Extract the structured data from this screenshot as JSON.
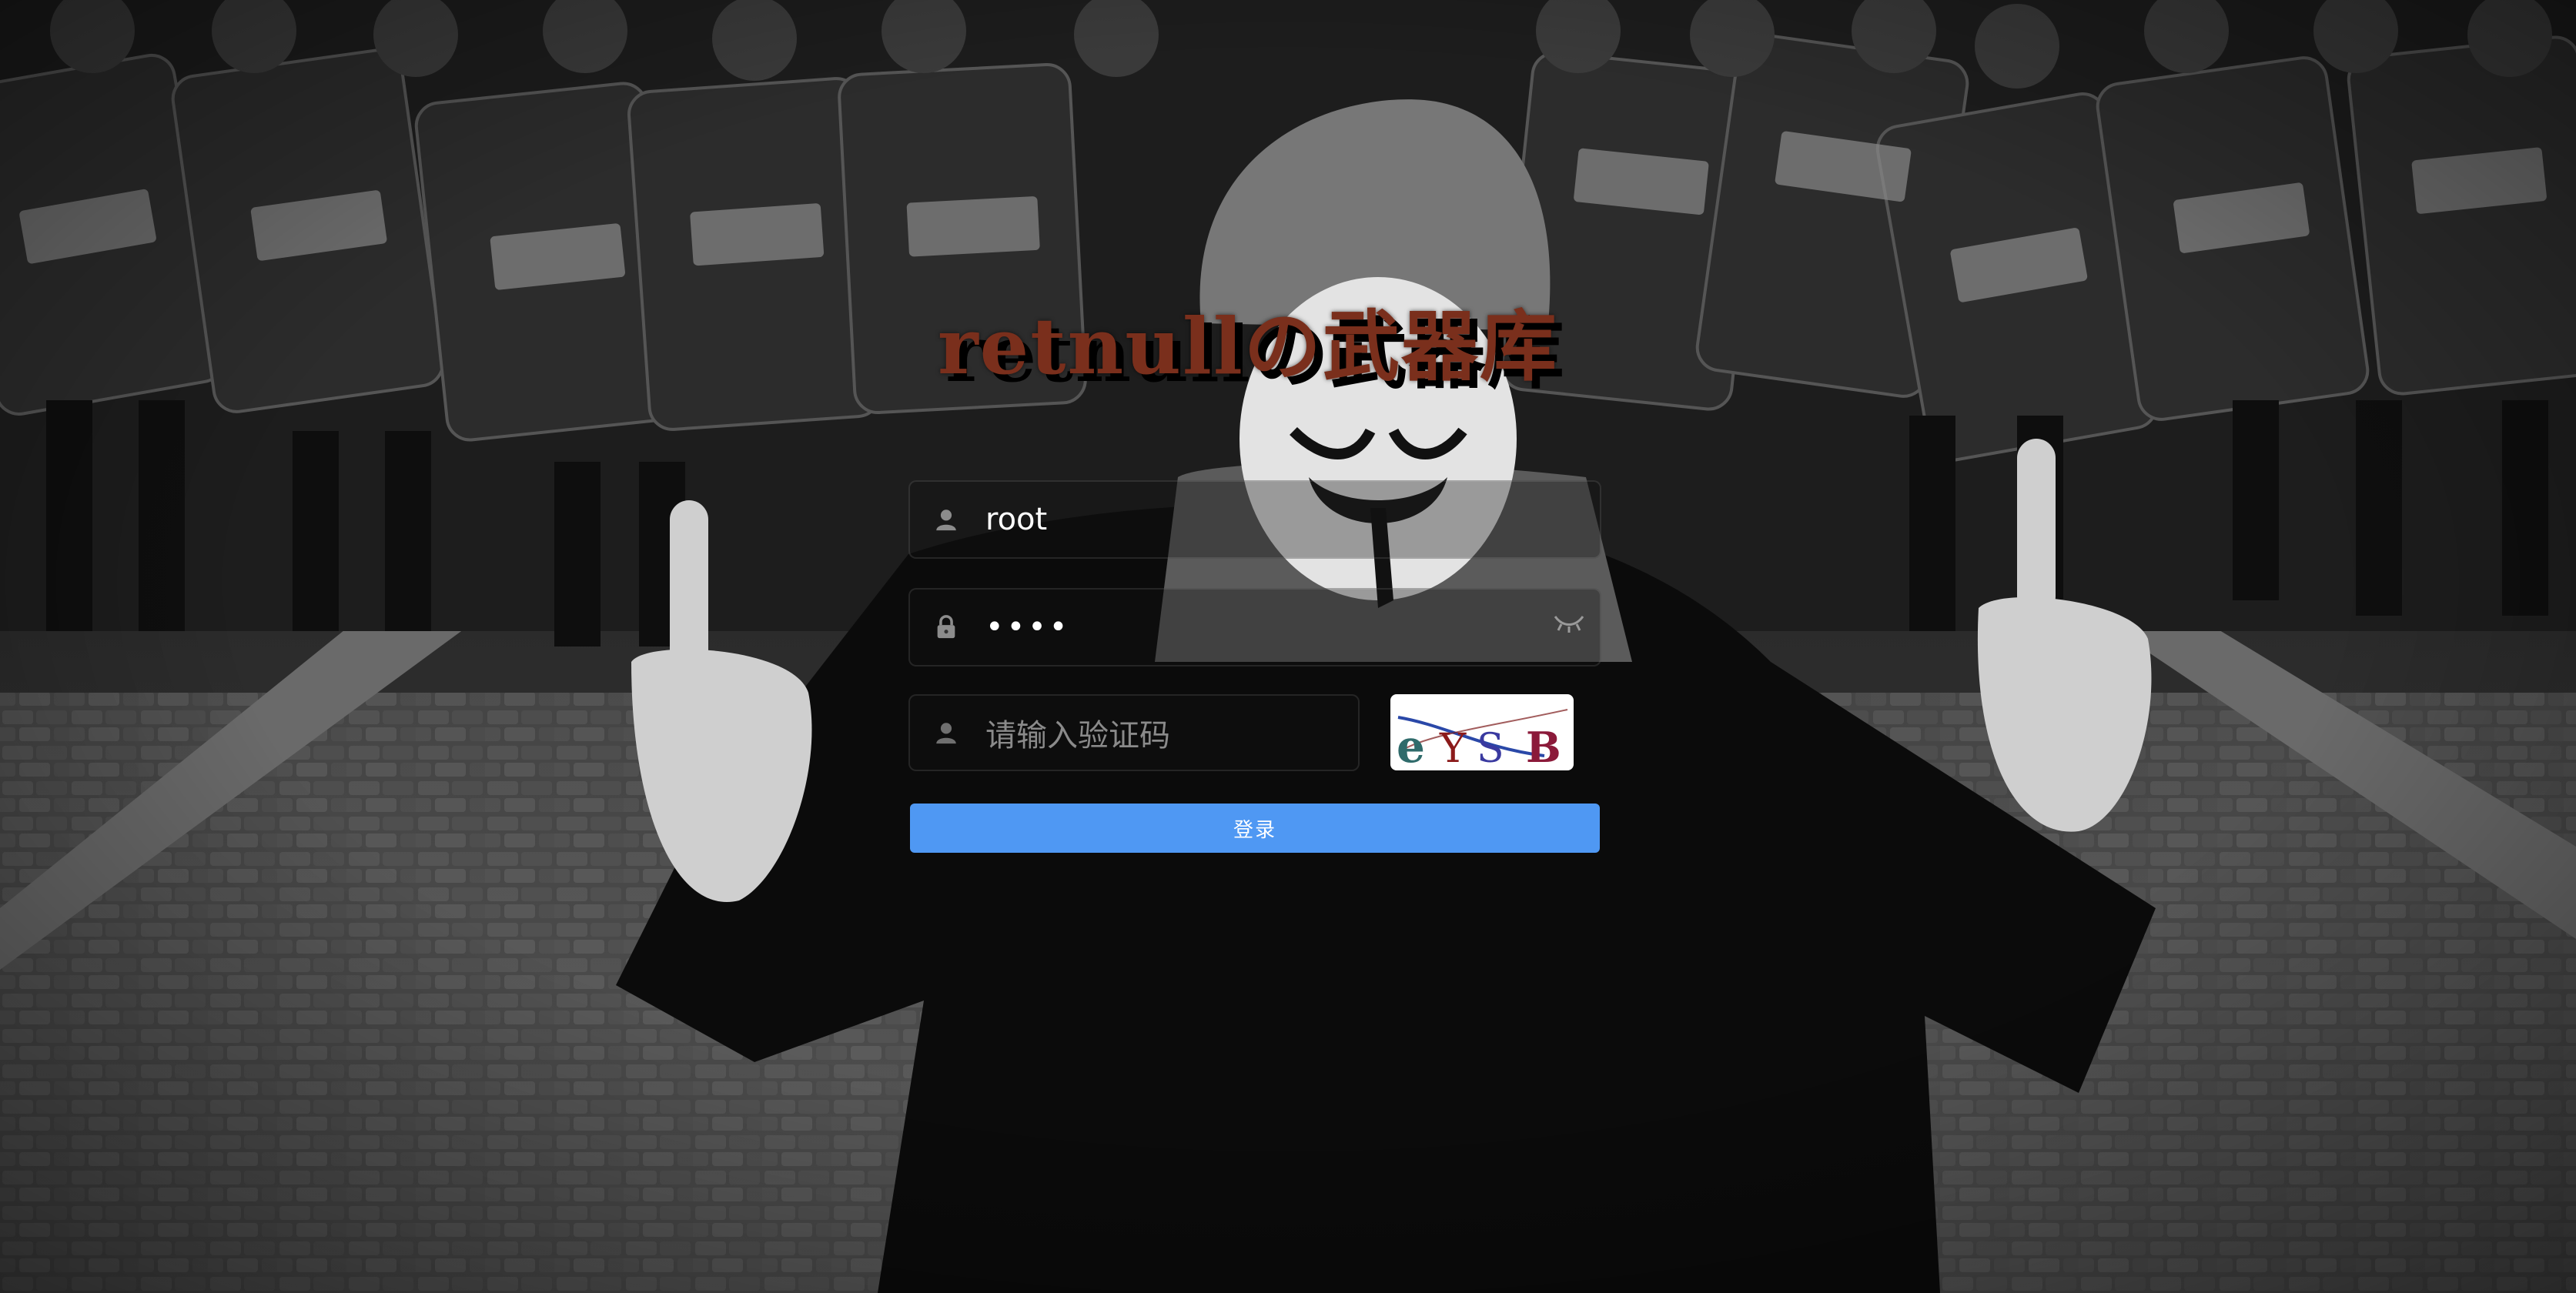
{
  "page": {
    "title": "retnullの武器库"
  },
  "login_form": {
    "username": {
      "value": "root",
      "icon": "user-icon"
    },
    "password": {
      "value": "••••",
      "icon": "lock-icon",
      "toggle_icon": "eye-closed-icon"
    },
    "captcha": {
      "placeholder": "请输入验证码",
      "icon": "user-icon",
      "image_text": "eYSB"
    },
    "submit_label": "登录"
  },
  "colors": {
    "title": "#7a2f1c",
    "button": "#4f98f3",
    "button_text": "#ffffff"
  }
}
